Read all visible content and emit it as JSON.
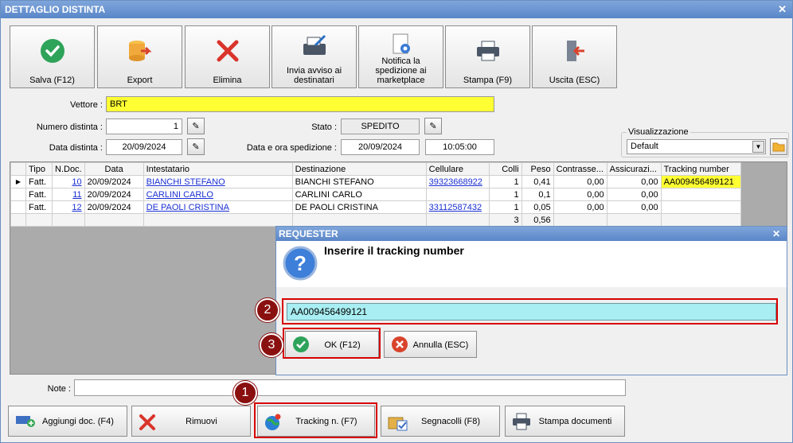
{
  "window": {
    "title": "DETTAGLIO DISTINTA"
  },
  "toolbar": [
    {
      "label": "Salva (F12)",
      "icon": "check-circle-icon"
    },
    {
      "label": "Export",
      "icon": "database-export-icon"
    },
    {
      "label": "Elimina",
      "icon": "red-x-icon"
    },
    {
      "label": "Invia avviso ai destinatari",
      "icon": "printer-pen-icon"
    },
    {
      "label": "Notifica la spedizione ai marketplace",
      "icon": "document-gear-icon"
    },
    {
      "label": "Stampa (F9)",
      "icon": "printer-icon"
    },
    {
      "label": "Uscita (ESC)",
      "icon": "exit-door-icon"
    }
  ],
  "form": {
    "vettore_label": "Vettore :",
    "vettore": "BRT",
    "numero_label": "Numero distinta :",
    "numero": "1",
    "data_label": "Data distinta :",
    "data": "20/09/2024",
    "stato_label": "Stato :",
    "stato": "SPEDITO",
    "spedizione_label": "Data e ora spedizione :",
    "spedizione_data": "20/09/2024",
    "spedizione_ora": "10:05:00",
    "visualizzazione_label": "Visualizzazione",
    "visualizzazione": "Default",
    "note_label": "Note :"
  },
  "table": {
    "headers": [
      "Tipo",
      "N.Doc.",
      "Data",
      "Intestatario",
      "Destinazione",
      "Cellulare",
      "Colli",
      "Peso",
      "Contrasse...",
      "Assicurazi...",
      "Tracking number"
    ],
    "rows": [
      {
        "tipo": "Fatt.",
        "ndoc": "10",
        "data": "20/09/2024",
        "intestatario": "BIANCHI STEFANO",
        "destinazione": "BIANCHI STEFANO",
        "cellulare": "39323668922",
        "colli": "1",
        "peso": "0,41",
        "contrassegno": "0,00",
        "assicurazione": "0,00",
        "tracking": "AA009456499121"
      },
      {
        "tipo": "Fatt.",
        "ndoc": "11",
        "data": "20/09/2024",
        "intestatario": "CARLINI CARLO",
        "destinazione": "CARLINI CARLO",
        "cellulare": "",
        "colli": "1",
        "peso": "0,1",
        "contrassegno": "0,00",
        "assicurazione": "0,00",
        "tracking": ""
      },
      {
        "tipo": "Fatt.",
        "ndoc": "12",
        "data": "20/09/2024",
        "intestatario": "DE PAOLI CRISTINA",
        "destinazione": "DE PAOLI CRISTINA",
        "cellulare": "33112587432",
        "colli": "1",
        "peso": "0,05",
        "contrassegno": "0,00",
        "assicurazione": "0,00",
        "tracking": ""
      }
    ],
    "totals": {
      "colli": "3",
      "peso": "0,56"
    }
  },
  "dialog": {
    "title": "REQUESTER",
    "message": "Inserire il tracking number",
    "input_value": "AA009456499121",
    "ok_label": "OK (F12)",
    "cancel_label": "Annulla (ESC)"
  },
  "bottom": [
    {
      "label": "Aggiungi doc. (F4)"
    },
    {
      "label": "Rimuovi"
    },
    {
      "label": "Tracking n. (F7)"
    },
    {
      "label": "Segnacolli (F8)"
    },
    {
      "label": "Stampa documenti"
    }
  ],
  "badges": [
    "1",
    "2",
    "3"
  ],
  "colors": {
    "title": "#5a86c8",
    "highlight": "#ffff33",
    "input_active": "#a8eef2",
    "red_frame": "#d80000",
    "badge": "#8a1010"
  }
}
